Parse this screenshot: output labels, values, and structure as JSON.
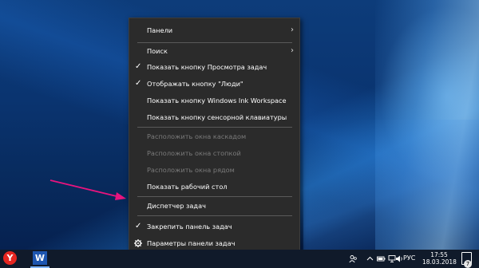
{
  "context_menu": {
    "items": [
      {
        "label": "Панели",
        "checked": false,
        "submenu": true,
        "disabled": false
      },
      {
        "label": "Поиск",
        "checked": false,
        "submenu": true,
        "disabled": false
      },
      {
        "label": "Показать кнопку Просмотра задач",
        "checked": true,
        "submenu": false,
        "disabled": false
      },
      {
        "label": "Отображать кнопку \"Люди\"",
        "checked": true,
        "submenu": false,
        "disabled": false
      },
      {
        "label": "Показать кнопку Windows Ink Workspace",
        "checked": false,
        "submenu": false,
        "disabled": false
      },
      {
        "label": "Показать кнопку сенсорной клавиатуры",
        "checked": false,
        "submenu": false,
        "disabled": false
      },
      {
        "label": "Расположить окна каскадом",
        "checked": false,
        "submenu": false,
        "disabled": true
      },
      {
        "label": "Расположить окна стопкой",
        "checked": false,
        "submenu": false,
        "disabled": true
      },
      {
        "label": "Расположить окна рядом",
        "checked": false,
        "submenu": false,
        "disabled": true
      },
      {
        "label": "Показать рабочий стол",
        "checked": false,
        "submenu": false,
        "disabled": false
      },
      {
        "label": "Диспетчер задач",
        "checked": false,
        "submenu": false,
        "disabled": false
      },
      {
        "label": "Закрепить панель задач",
        "checked": true,
        "submenu": false,
        "disabled": false
      },
      {
        "label": "Параметры панели задач",
        "checked": false,
        "submenu": false,
        "disabled": false
      }
    ]
  },
  "taskbar": {
    "yandex_letter": "Y",
    "word_letter": "W",
    "language": "РУС",
    "time": "17:55",
    "date": "18.03.2018",
    "notification_count": "7"
  },
  "colors": {
    "menu_bg": "#2b2b2b",
    "arrow": "#e8147e",
    "taskbar_bg": "#101a2a"
  }
}
